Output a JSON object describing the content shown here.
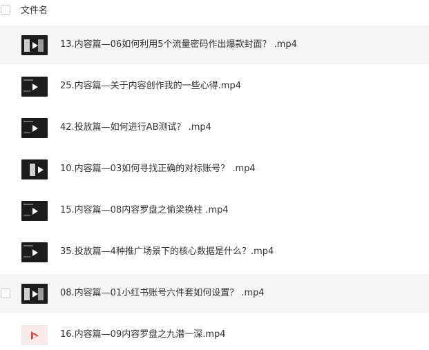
{
  "header": {
    "column_label": "文件名"
  },
  "files": [
    {
      "name": "13.内容篇—06如何利用5个流量密码作出爆款封面？ .mp4",
      "highlighted": true,
      "thumb": "dark-pics"
    },
    {
      "name": "25.内容篇—关于内容创作我的一些心得.mp4",
      "highlighted": false,
      "thumb": "dark"
    },
    {
      "name": "42.投放篇—如何进行AB测试？ .mp4",
      "highlighted": false,
      "thumb": "dark"
    },
    {
      "name": "10.内容篇—03如何寻找正确的对标账号？ .mp4",
      "highlighted": false,
      "thumb": "dark-pics"
    },
    {
      "name": "15.内容篇—08内容罗盘之偷梁换柱 .mp4",
      "highlighted": false,
      "thumb": "dark"
    },
    {
      "name": "35.投放篇—4种推广场景下的核心数据是什么？.mp4",
      "highlighted": false,
      "thumb": "dark"
    },
    {
      "name": "08.内容篇—01小红书账号六件套如何设置？ .mp4",
      "highlighted": true,
      "thumb": "dark-pics"
    },
    {
      "name": "16.内容篇—09内容罗盘之九潜一深.mp4",
      "highlighted": false,
      "thumb": "video-file-icon"
    }
  ],
  "colors": {
    "row_highlight": "#f5f5f5",
    "video_icon_red": "#e24b4b",
    "text": "#333333"
  }
}
